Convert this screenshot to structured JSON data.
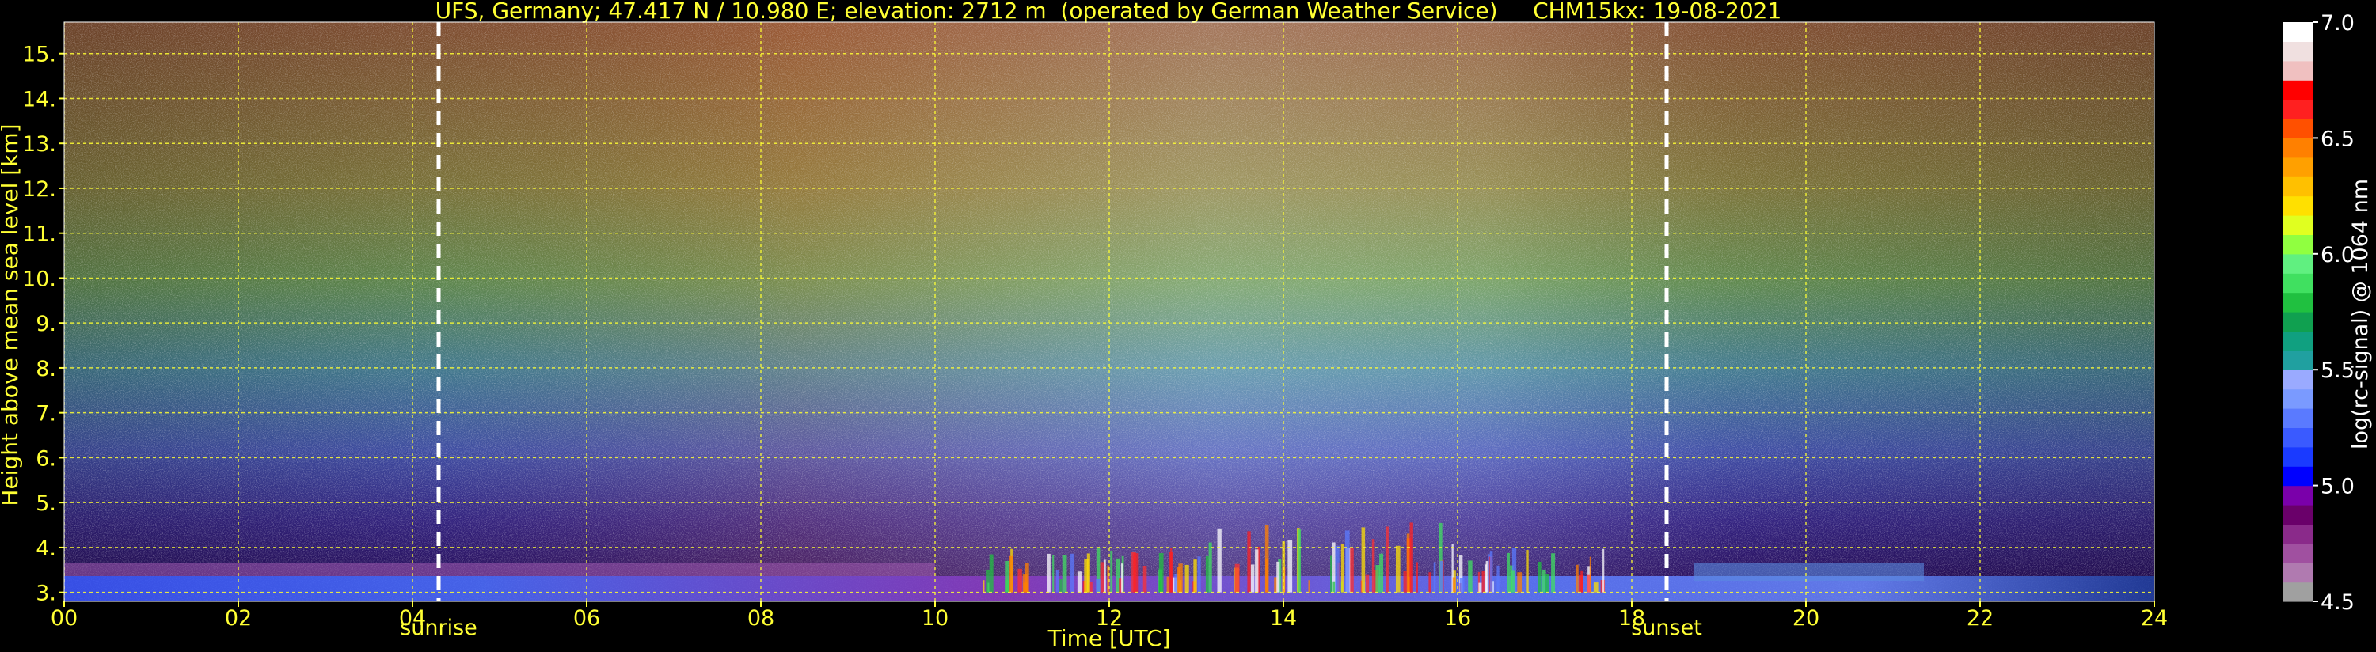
{
  "chart_data": {
    "type": "heatmap",
    "title": "UFS, Germany; 47.417 N / 10.980 E; elevation: 2712 m  (operated by German Weather Service)     CHM15kx: 19-08-2021",
    "xlabel": "Time [UTC]",
    "ylabel": "Height above mean sea level [km]",
    "xlim": [
      0,
      24
    ],
    "ylim": [
      2.8,
      15.7
    ],
    "x_ticks": [
      "00",
      "02",
      "04",
      "06",
      "08",
      "10",
      "12",
      "14",
      "16",
      "18",
      "20",
      "22",
      "24"
    ],
    "y_ticks": [
      "3.",
      "4.",
      "5.",
      "6.",
      "7.",
      "8.",
      "9.",
      "10.",
      "11.",
      "12.",
      "13.",
      "14.",
      "15."
    ],
    "grid": true,
    "events": [
      {
        "label": "sunrise",
        "time_hours": 4.3
      },
      {
        "label": "sunset",
        "time_hours": 18.4
      }
    ],
    "colorbar": {
      "label": "log(rc-signal) @ 1064 nm",
      "range": [
        4.5,
        7.0
      ],
      "ticks": [
        "4.5",
        "5.0",
        "5.5",
        "6.0",
        "6.5",
        "7.0"
      ],
      "colors": [
        "#a0a0a0",
        "#b07ab0",
        "#a050a0",
        "#8a2a8a",
        "#6a006a",
        "#7a00aa",
        "#0000ff",
        "#1a3aff",
        "#3a5aff",
        "#5a7aff",
        "#7a9aff",
        "#9aaaff",
        "#20a0a0",
        "#10a080",
        "#10a050",
        "#20c040",
        "#40e060",
        "#60f080",
        "#90ff40",
        "#e0ff20",
        "#ffe000",
        "#ffc000",
        "#ffa000",
        "#ff8000",
        "#ff5000",
        "#ff2020",
        "#ff0000",
        "#f0c0c0",
        "#f0e0e0",
        "#ffffff"
      ]
    }
  }
}
